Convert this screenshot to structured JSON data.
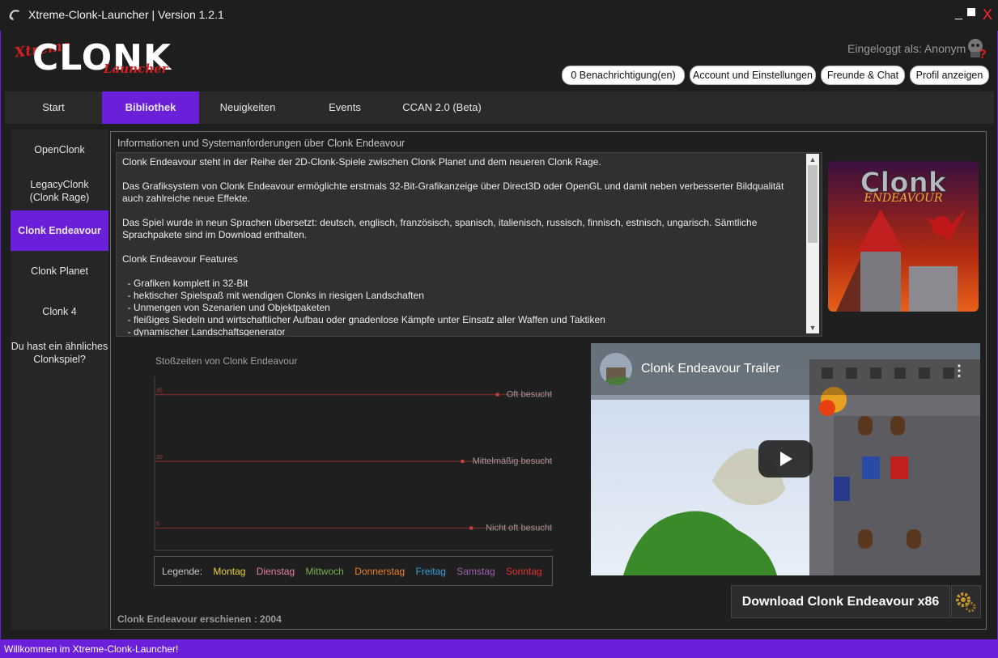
{
  "window": {
    "title": "Xtreme-Clonk-Launcher | Version 1.2.1",
    "minimize": "_",
    "close": "X"
  },
  "logo": {
    "top": "Xtreme",
    "main": "CLONK",
    "sub": "Launcher"
  },
  "header": {
    "login_status": "Eingeloggt als: Anonym",
    "buttons": [
      "0 Benachrichtigung(en)",
      "Account und Einstellungen",
      "Freunde & Chat",
      "Profil anzeigen"
    ]
  },
  "tabs": [
    {
      "label": "Start",
      "active": false
    },
    {
      "label": "Bibliothek",
      "active": true
    },
    {
      "label": "Neuigkeiten",
      "active": false
    },
    {
      "label": "Events",
      "active": false
    },
    {
      "label": "CCAN 2.0 (Beta)",
      "active": false
    }
  ],
  "sidebar": {
    "items": [
      {
        "label": "OpenClonk",
        "active": false
      },
      {
        "label": "LegacyClonk\n(Clonk Rage)",
        "active": false
      },
      {
        "label": "Clonk Endeavour",
        "active": true
      },
      {
        "label": "Clonk Planet",
        "active": false
      },
      {
        "label": "Clonk 4",
        "active": false
      },
      {
        "label": "Du hast ein ähnliches\nClonkspiel?",
        "active": false
      }
    ]
  },
  "main": {
    "heading": "Informationen und Systemanforderungen über Clonk Endeavour",
    "description": "Clonk Endeavour steht in der Reihe der 2D-Clonk-Spiele zwischen Clonk Planet und dem neueren Clonk Rage.\n\nDas Grafiksystem von Clonk Endeavour ermöglichte erstmals 32-Bit-Grafikanzeige über Direct3D oder OpenGL und damit neben verbesserter Bildqualität auch zahlreiche neue Effekte.\n\nDas Spiel wurde in neun Sprachen übersetzt: deutsch, englisch, französisch, spanisch, italienisch, russisch, finnisch, estnisch, ungarisch. Sämtliche Sprachpakete sind im Download enthalten.\n\nClonk Endeavour Features\n\n  - Grafiken komplett in 32-Bit\n  - hektischer Spielspaß mit wendigen Clonks in riesigen Landschaften\n  - Unmengen von Szenarien und Objektpaketen\n  - fleißiges Siedeln und wirtschaftlicher Aufbau oder gnadenlose Kämpfe unter Einsatz aller Waffen und Taktiken\n  - dynamischer Landschaftsgenerator",
    "cover_text": "Clonk",
    "cover_sub": "ENDEAVOUR",
    "release": "Clonk Endeavour erschienen : 2004",
    "download_label": "Download Clonk Endeavour x86"
  },
  "chart_data": {
    "type": "line",
    "title": "Stoßzeiten von Clonk Endeavour",
    "y_ticks": [
      35,
      20,
      5
    ],
    "levels": [
      "Oft besucht",
      "Mittelmäßig besucht",
      "Nicht oft besucht"
    ],
    "legend_label": "Legende:",
    "legend": [
      {
        "name": "Montag",
        "color": "#e8d02a"
      },
      {
        "name": "Dienstag",
        "color": "#e87fa8"
      },
      {
        "name": "Mittwoch",
        "color": "#6fb04a"
      },
      {
        "name": "Donnerstag",
        "color": "#e8822a"
      },
      {
        "name": "Freitag",
        "color": "#3a9ed8"
      },
      {
        "name": "Samstag",
        "color": "#a05fb0"
      },
      {
        "name": "Sonntag",
        "color": "#e03030"
      }
    ],
    "grid_color": "#6a2a2a"
  },
  "video": {
    "title": "Clonk Endeavour Trailer"
  },
  "statusbar": {
    "text": "Willkommen im Xtreme-Clonk-Launcher!"
  },
  "colors": {
    "accent": "#6b1fd8",
    "background": "#1e1e1e"
  }
}
